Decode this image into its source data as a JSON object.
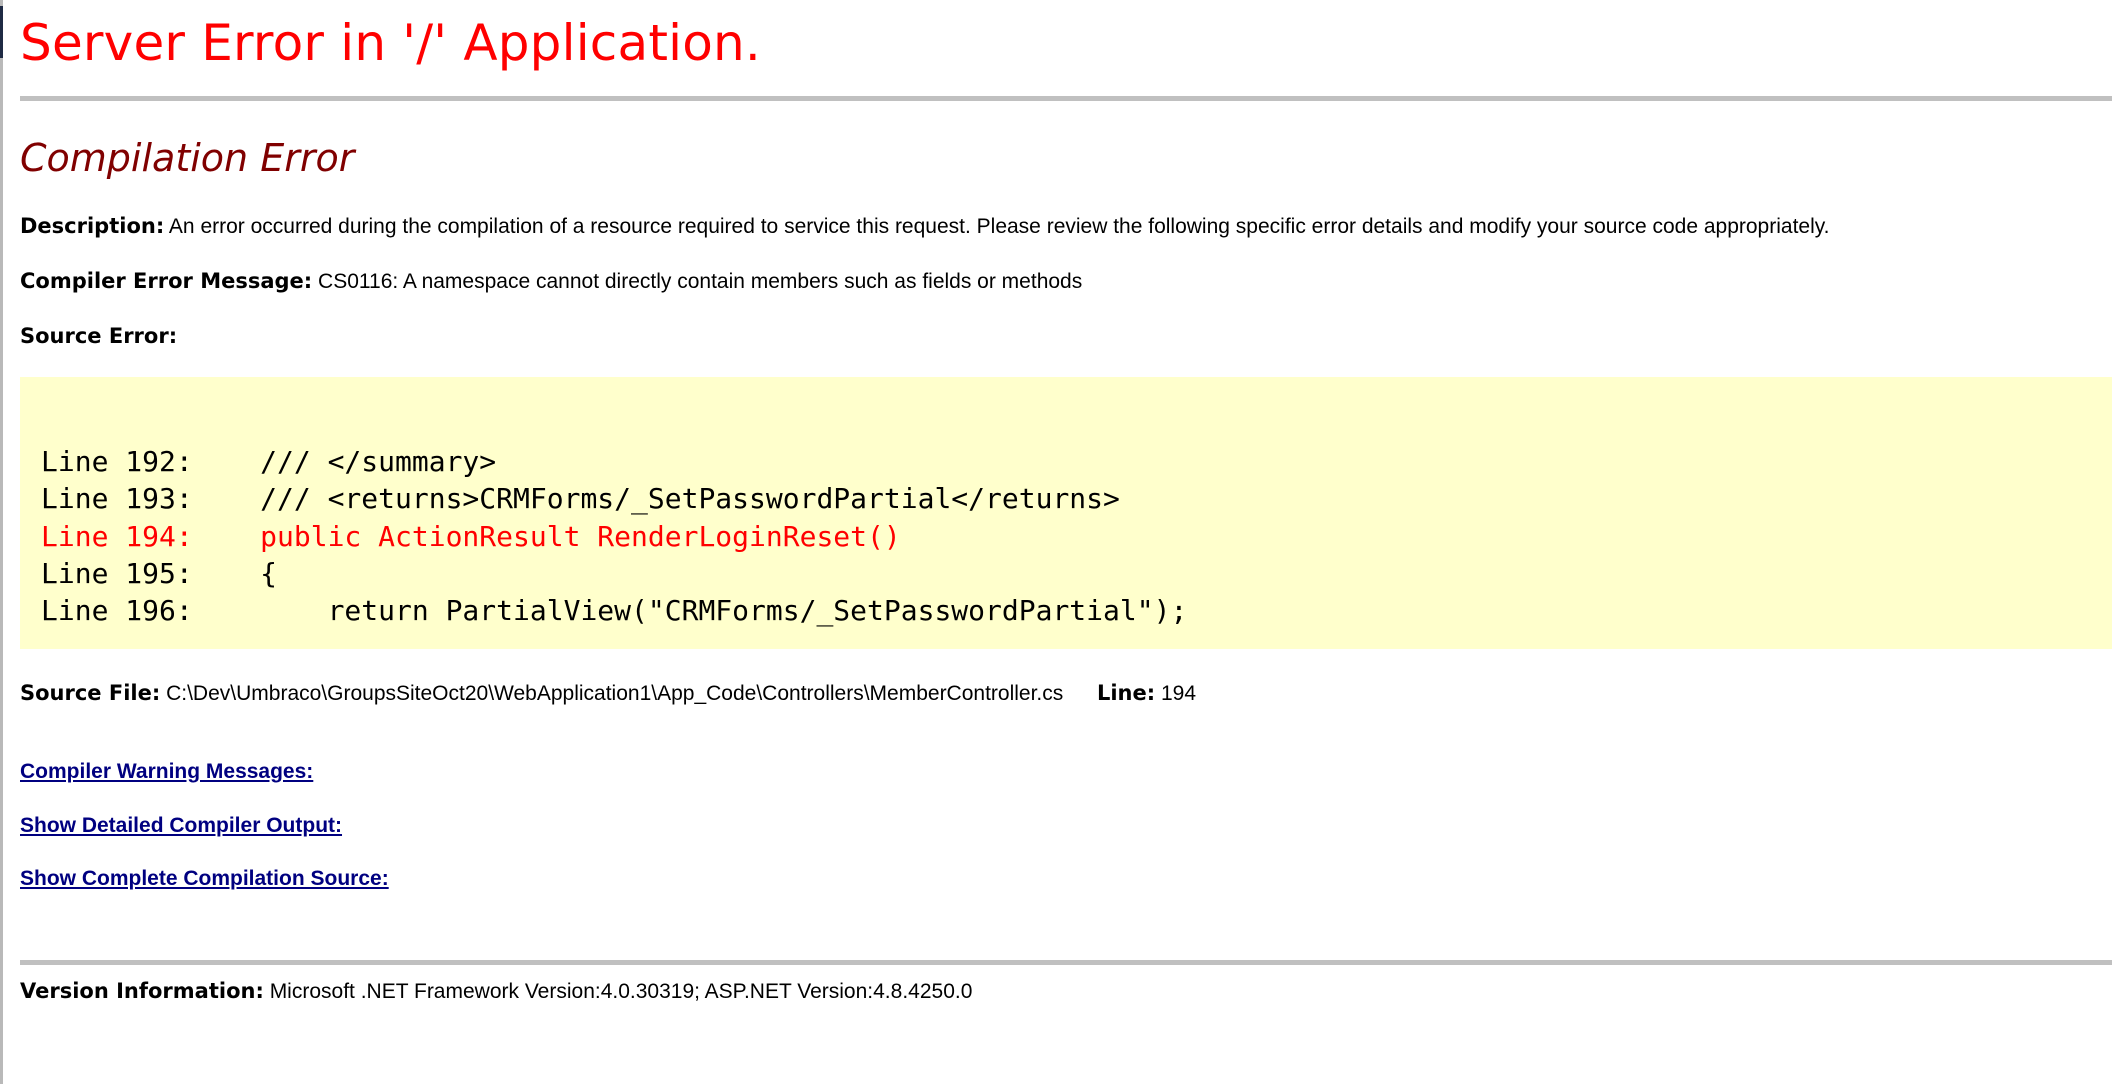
{
  "page": {
    "title": "Server Error in '/' Application.",
    "subtitle": "Compilation Error"
  },
  "description": {
    "label": "Description:",
    "text": "An error occurred during the compilation of a resource required to service this request. Please review the following specific error details and modify your source code appropriately."
  },
  "compiler_error": {
    "label": "Compiler Error Message:",
    "text": "CS0116: A namespace cannot directly contain members such as fields or methods"
  },
  "source_error": {
    "label": "Source Error:",
    "lines": [
      {
        "text": "Line 192:    /// </summary>",
        "is_error": false
      },
      {
        "text": "Line 193:    /// <returns>CRMForms/_SetPasswordPartial</returns>",
        "is_error": false
      },
      {
        "text": "Line 194:    public ActionResult RenderLoginReset()",
        "is_error": true
      },
      {
        "text": "Line 195:    {",
        "is_error": false
      },
      {
        "text": "Line 196:        return PartialView(\"CRMForms/_SetPasswordPartial\");",
        "is_error": false
      }
    ]
  },
  "source_file": {
    "label": "Source File:",
    "path": "C:\\Dev\\Umbraco\\GroupsSiteOct20\\WebApplication1\\App_Code\\Controllers\\MemberController.cs",
    "line_label": "Line:",
    "line_value": "194"
  },
  "links": {
    "compiler_warnings": "Compiler Warning Messages:",
    "detailed_output": "Show Detailed Compiler Output:",
    "complete_source": "Show Complete Compilation Source:"
  },
  "version": {
    "label": "Version Information:",
    "text": "Microsoft .NET Framework Version:4.0.30319; ASP.NET Version:4.8.4250.0"
  },
  "colors": {
    "title": "#ff0000",
    "subtitle": "#800000",
    "code_background": "#ffffcc",
    "error_line": "#ff0000",
    "link": "#000080",
    "rule": "#c0c0c0"
  }
}
